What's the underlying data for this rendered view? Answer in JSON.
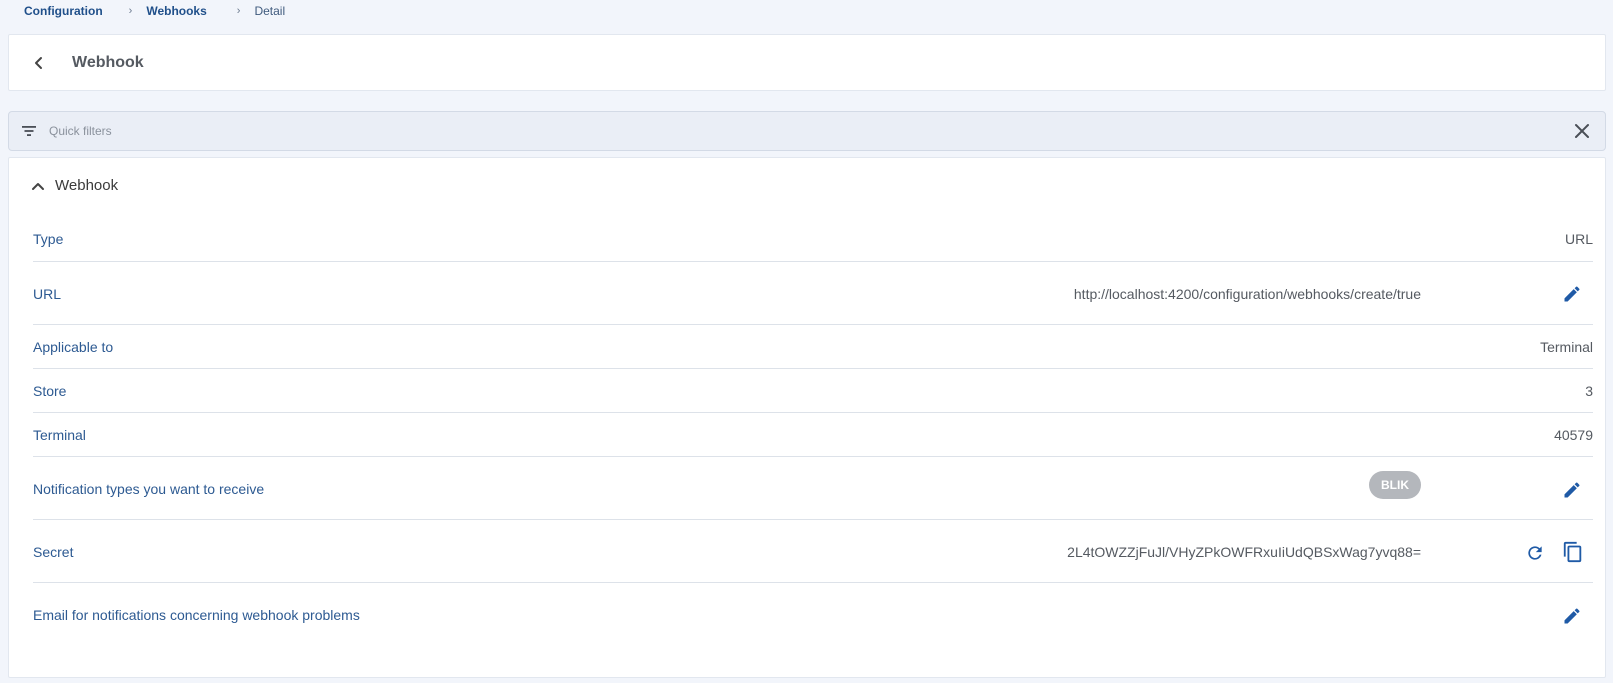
{
  "breadcrumb": {
    "items": [
      "Configuration",
      "Webhooks",
      "Detail"
    ]
  },
  "header": {
    "title": "Webhook",
    "back_icon": "chevron-left-icon"
  },
  "filters": {
    "placeholder": "Quick filters",
    "value": "",
    "filter_icon": "filter-list-icon",
    "clear_icon": "close-icon"
  },
  "section": {
    "title": "Webhook",
    "expanded": true,
    "toggle_icon": "chevron-up-icon"
  },
  "fields": {
    "type": {
      "label": "Type",
      "value": "URL"
    },
    "url": {
      "label": "URL",
      "value": "http://localhost:4200/configuration/webhooks/create/true"
    },
    "applicable_to": {
      "label": "Applicable to",
      "value": "Terminal"
    },
    "store": {
      "label": "Store",
      "value": "3"
    },
    "terminal": {
      "label": "Terminal",
      "value": "40579"
    },
    "notification_types": {
      "label": "Notification types you want to receive",
      "badges": [
        "BLIK"
      ]
    },
    "secret": {
      "label": "Secret",
      "value": "2L4tOWZZjFuJl/VHyZPkOWFRxuIiUdQBSxWag7yvq88="
    },
    "email": {
      "label": "Email for notifications concerning webhook problems",
      "value": ""
    }
  },
  "colors": {
    "accent": "#1f5aa6",
    "label": "#2d5a92",
    "badge": "#b4b7bc",
    "page_bg": "#f2f5fb"
  }
}
